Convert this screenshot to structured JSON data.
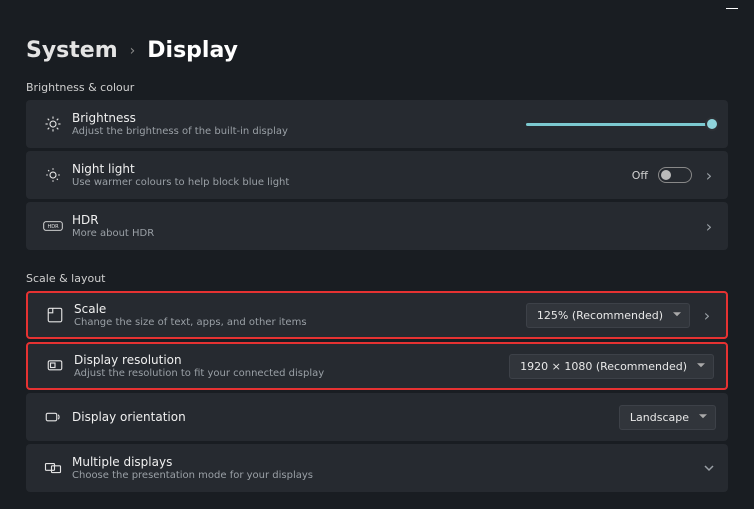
{
  "breadcrumb": {
    "root": "System",
    "leaf": "Display"
  },
  "sections": {
    "brightness_colour": {
      "label": "Brightness & colour"
    },
    "scale_layout": {
      "label": "Scale & layout"
    }
  },
  "rows": {
    "brightness": {
      "title": "Brightness",
      "desc": "Adjust the brightness of the built-in display"
    },
    "night_light": {
      "title": "Night light",
      "desc": "Use warmer colours to help block blue light",
      "toggle_label": "Off"
    },
    "hdr": {
      "title": "HDR",
      "desc": "More about HDR"
    },
    "scale": {
      "title": "Scale",
      "desc": "Change the size of text, apps, and other items",
      "value": "125% (Recommended)"
    },
    "resolution": {
      "title": "Display resolution",
      "desc": "Adjust the resolution to fit your connected display",
      "value": "1920 × 1080 (Recommended)"
    },
    "orientation": {
      "title": "Display orientation",
      "value": "Landscape"
    },
    "multiple": {
      "title": "Multiple displays",
      "desc": "Choose the presentation mode for your displays"
    }
  }
}
